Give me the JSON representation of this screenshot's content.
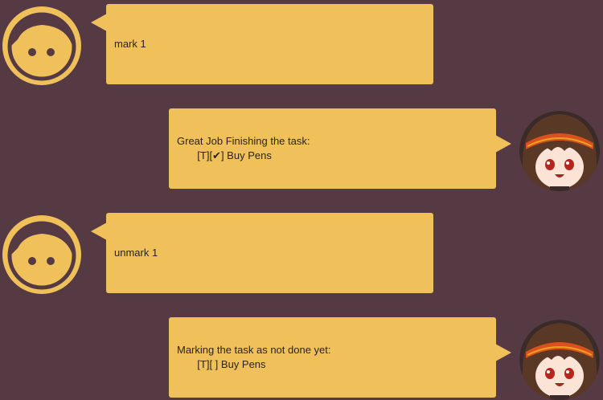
{
  "colors": {
    "background": "#563a43",
    "bubble": "#f0c15a",
    "user_avatar_fill": "#f0c15a",
    "user_avatar_line": "#563a43"
  },
  "icons": {
    "user_avatar": "smiley-face-icon",
    "bot_avatar": "anime-girl-avatar-icon"
  },
  "messages": [
    {
      "sender": "user",
      "text": "mark 1"
    },
    {
      "sender": "bot",
      "text": "Great Job Finishing the task:\n       [T][✔] Buy Pens"
    },
    {
      "sender": "user",
      "text": "unmark 1"
    },
    {
      "sender": "bot",
      "text": "Marking the task as not done yet:\n       [T][ ] Buy Pens"
    }
  ]
}
